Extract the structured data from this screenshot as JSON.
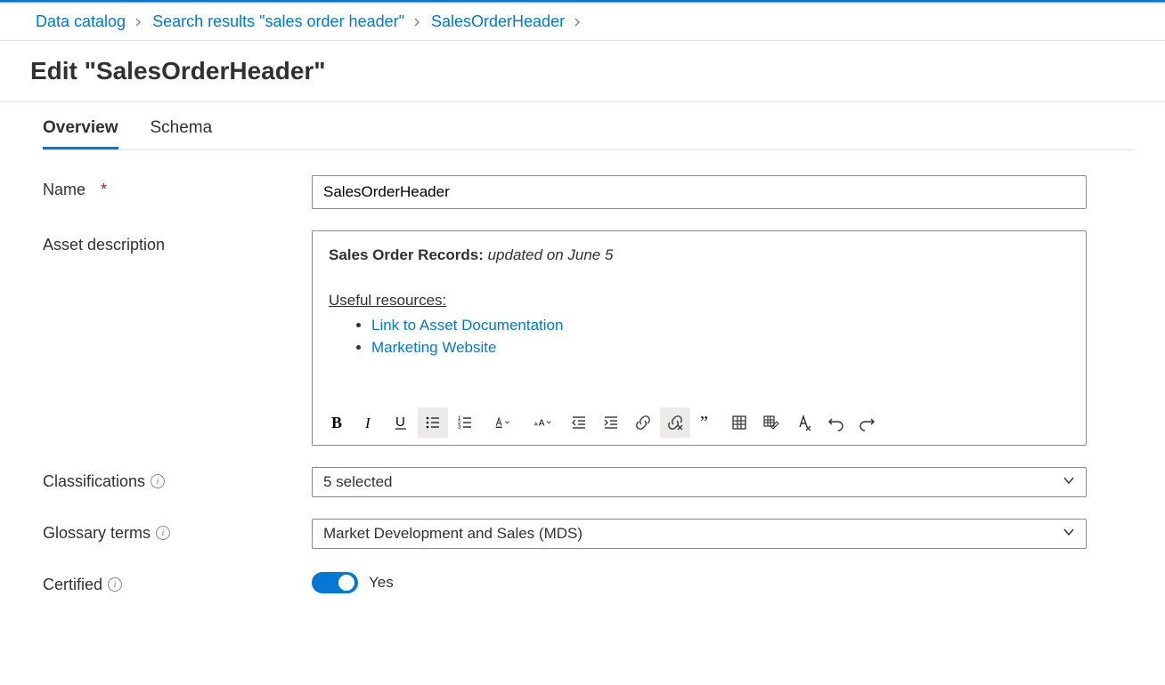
{
  "breadcrumb": {
    "items": [
      {
        "label": "Data catalog"
      },
      {
        "label": "Search results \"sales order header\""
      },
      {
        "label": "SalesOrderHeader"
      }
    ]
  },
  "page_title": "Edit \"SalesOrderHeader\"",
  "tabs": {
    "overview": "Overview",
    "schema": "Schema"
  },
  "form": {
    "name_label": "Name",
    "name_value": "SalesOrderHeader",
    "desc_label": "Asset description",
    "desc": {
      "title_bold": "Sales Order Records:",
      "title_italic": " updated on June 5",
      "resources_heading": "Useful resources:",
      "link1": "Link to Asset Documentation",
      "link2": "Marketing Website"
    },
    "classifications_label": "Classifications",
    "classifications_value": "5 selected",
    "glossary_label": "Glossary terms",
    "glossary_value": "Market Development and Sales (MDS)",
    "certified_label": "Certified",
    "certified_value": "Yes"
  }
}
